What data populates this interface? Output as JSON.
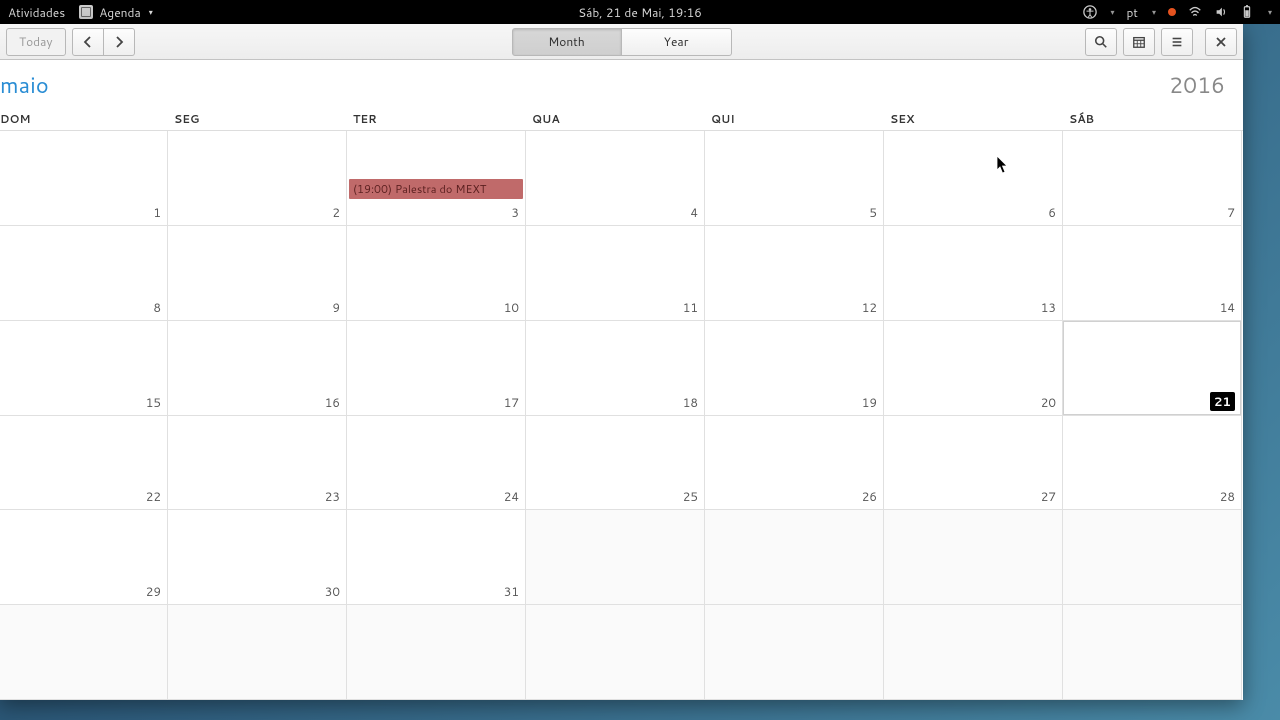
{
  "panel": {
    "activities": "Atividades",
    "app_name": "Agenda",
    "clock": "Sáb, 21 de Mai, 19:16",
    "lang": "pt"
  },
  "headerbar": {
    "today": "Today",
    "views": {
      "month": "Month",
      "year": "Year"
    }
  },
  "calendar": {
    "month_label": "maio",
    "year_label": "2016",
    "dow": [
      "DOM",
      "SEG",
      "TER",
      "QUA",
      "QUI",
      "SEX",
      "SÁB"
    ],
    "event": {
      "label": "(19:00) Palestra do MEXT",
      "day": 3
    },
    "today": 21,
    "weeks": [
      [
        1,
        2,
        3,
        4,
        5,
        6,
        7
      ],
      [
        8,
        9,
        10,
        11,
        12,
        13,
        14
      ],
      [
        15,
        16,
        17,
        18,
        19,
        20,
        21
      ],
      [
        22,
        23,
        24,
        25,
        26,
        27,
        28
      ],
      [
        29,
        30,
        31,
        null,
        null,
        null,
        null
      ],
      [
        null,
        null,
        null,
        null,
        null,
        null,
        null
      ]
    ]
  }
}
